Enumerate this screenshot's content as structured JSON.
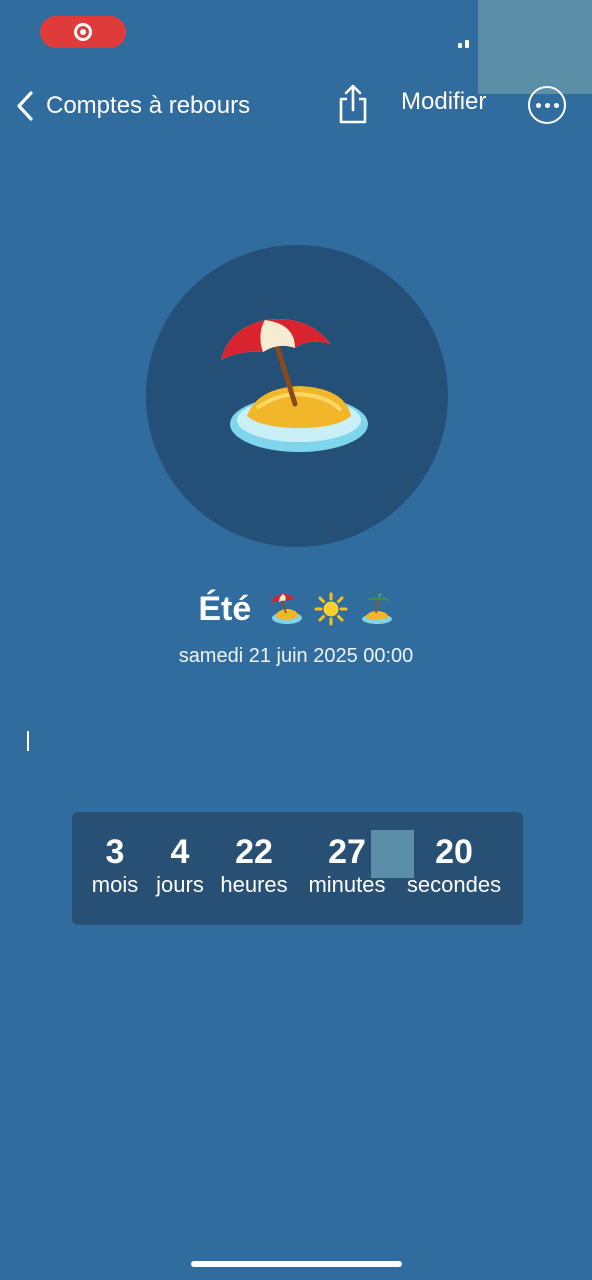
{
  "status_bar": {
    "recording_icon": "screen-recording-icon",
    "signal_icon": "cellular-signal-icon"
  },
  "nav": {
    "back_label": "Comptes à rebours",
    "back_icon": "chevron-left-icon",
    "share_icon": "share-icon",
    "edit_label": "Modifier",
    "more_icon": "ellipsis-circle-icon"
  },
  "event": {
    "icon": "beach-umbrella-icon",
    "title": "Été",
    "title_emojis": [
      "beach-umbrella-icon",
      "sun-icon",
      "desert-island-icon"
    ],
    "date": "samedi 21 juin 2025 00:00"
  },
  "countdown": {
    "months": {
      "value": "3",
      "label": "mois"
    },
    "days": {
      "value": "4",
      "label": "jours"
    },
    "hours": {
      "value": "22",
      "label": "heures"
    },
    "minutes": {
      "value": "27",
      "label": "minutes"
    },
    "seconds": {
      "value": "20",
      "label": "secondes"
    }
  },
  "colors": {
    "background": "#316c9f",
    "hero_circle": "#244f77",
    "countdown_panel": "#284f74",
    "record_pill": "#e03b3b"
  }
}
